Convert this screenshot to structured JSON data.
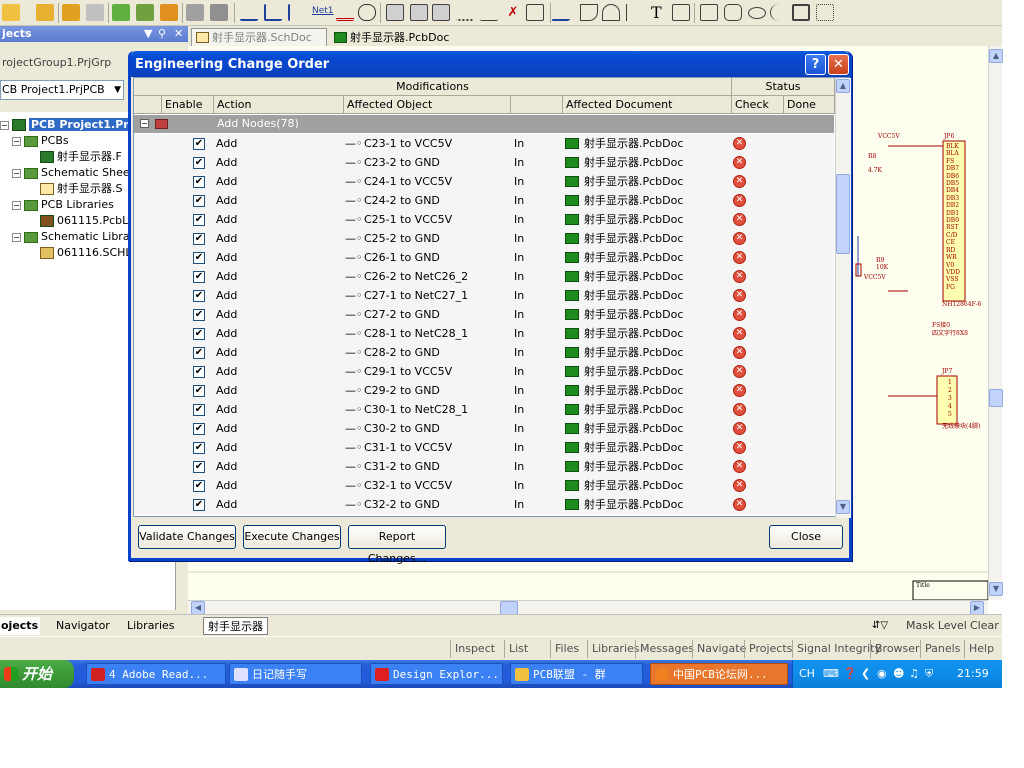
{
  "toolbar": {
    "icons": [
      "open-icon",
      "folder-icon",
      "open-project-icon",
      "close-icon",
      "copy-icon",
      "paste-icon",
      "export-icon",
      "compile-icon",
      "cross-probe-icon",
      "wire-icon",
      "bus-icon",
      "bus-entry-icon",
      "net-label",
      "gnd-icon",
      "port-icon",
      "part-icon",
      "sheet-icon",
      "sheet-entry-icon",
      "harness-icon",
      "junction-icon",
      "no-erc-icon",
      "probe-icon",
      "line-icon",
      "arc-icon",
      "arc2-icon",
      "bezier-icon",
      "text-icon",
      "textframe-icon",
      "rect-icon",
      "rounded-rect-icon",
      "ellipse-icon",
      "pie-icon",
      "image-icon",
      "array-icon"
    ],
    "net_label": "Net1",
    "text_label": "T"
  },
  "projects_panel": {
    "title": "jects",
    "workspace": "rojectGroup1.PrjGrp",
    "project": "CB Project1.PrjPCB",
    "tree": [
      {
        "label": "PCB Project1.PrjP",
        "level": 0,
        "selected": true
      },
      {
        "label": "PCBs",
        "level": 1
      },
      {
        "label": "射手显示器.F",
        "level": 2
      },
      {
        "label": "Schematic Sheets",
        "level": 1
      },
      {
        "label": "射手显示器.S",
        "level": 2
      },
      {
        "label": "PCB Libraries",
        "level": 1
      },
      {
        "label": "061115.PcbLi",
        "level": 2
      },
      {
        "label": "Schematic Librari",
        "level": 1
      },
      {
        "label": "061116.SCHL",
        "level": 2
      }
    ]
  },
  "doc_tabs": [
    {
      "label": "射手显示器.SchDoc"
    },
    {
      "label": "射手显示器.PcbDoc"
    }
  ],
  "dialog": {
    "title": "Engineering Change Order",
    "help_label": "?",
    "close_x": "✕",
    "headers": {
      "modifications": "Modifications",
      "status": "Status",
      "enable": "Enable",
      "action": "Action",
      "affected_object": "Affected Object",
      "affected_document": "Affected Document",
      "check": "Check",
      "done": "Done"
    },
    "group": "Add Nodes(78)",
    "rows": [
      {
        "action": "Add",
        "object": "C23-1 to VCC5V",
        "in": "In",
        "doc": "射手显示器.PcbDoc"
      },
      {
        "action": "Add",
        "object": "C23-2 to GND",
        "in": "In",
        "doc": "射手显示器.PcbDoc"
      },
      {
        "action": "Add",
        "object": "C24-1 to VCC5V",
        "in": "In",
        "doc": "射手显示器.PcbDoc"
      },
      {
        "action": "Add",
        "object": "C24-2 to GND",
        "in": "In",
        "doc": "射手显示器.PcbDoc"
      },
      {
        "action": "Add",
        "object": "C25-1 to VCC5V",
        "in": "In",
        "doc": "射手显示器.PcbDoc"
      },
      {
        "action": "Add",
        "object": "C25-2 to GND",
        "in": "In",
        "doc": "射手显示器.PcbDoc"
      },
      {
        "action": "Add",
        "object": "C26-1 to GND",
        "in": "In",
        "doc": "射手显示器.PcbDoc"
      },
      {
        "action": "Add",
        "object": "C26-2 to NetC26_2",
        "in": "In",
        "doc": "射手显示器.PcbDoc"
      },
      {
        "action": "Add",
        "object": "C27-1 to NetC27_1",
        "in": "In",
        "doc": "射手显示器.PcbDoc"
      },
      {
        "action": "Add",
        "object": "C27-2 to GND",
        "in": "In",
        "doc": "射手显示器.PcbDoc"
      },
      {
        "action": "Add",
        "object": "C28-1 to NetC28_1",
        "in": "In",
        "doc": "射手显示器.PcbDoc"
      },
      {
        "action": "Add",
        "object": "C28-2 to GND",
        "in": "In",
        "doc": "射手显示器.PcbDoc"
      },
      {
        "action": "Add",
        "object": "C29-1 to VCC5V",
        "in": "In",
        "doc": "射手显示器.PcbDoc"
      },
      {
        "action": "Add",
        "object": "C29-2 to GND",
        "in": "In",
        "doc": "射手显示器.PcbDoc"
      },
      {
        "action": "Add",
        "object": "C30-1 to NetC28_1",
        "in": "In",
        "doc": "射手显示器.PcbDoc"
      },
      {
        "action": "Add",
        "object": "C30-2 to GND",
        "in": "In",
        "doc": "射手显示器.PcbDoc"
      },
      {
        "action": "Add",
        "object": "C31-1 to VCC5V",
        "in": "In",
        "doc": "射手显示器.PcbDoc"
      },
      {
        "action": "Add",
        "object": "C31-2 to GND",
        "in": "In",
        "doc": "射手显示器.PcbDoc"
      },
      {
        "action": "Add",
        "object": "C32-1 to VCC5V",
        "in": "In",
        "doc": "射手显示器.PcbDoc"
      },
      {
        "action": "Add",
        "object": "C32-2 to GND",
        "in": "In",
        "doc": "射手显示器.PcbDoc"
      }
    ],
    "buttons": {
      "validate": "Validate Changes",
      "execute": "Execute Changes",
      "report": "Report Changes...",
      "close": "Close"
    }
  },
  "schematic": {
    "labels": [
      "VCC5V",
      "JP6",
      "R8",
      "4.7K",
      "BLK",
      "BLA",
      "FS",
      "DB7",
      "DB6",
      "DB5",
      "DB4",
      "DB3",
      "DB2",
      "DB1",
      "DB0",
      "RST",
      "C/D",
      "CE",
      "RD",
      "WR",
      "V0",
      "VDD",
      "VSS",
      "FG",
      "R9",
      "10K",
      "VCC5V",
      "NH12864F-6",
      "FS接0",
      "四文字行8X8",
      "JP7",
      "1",
      "2",
      "3",
      "4",
      "5",
      "无线模块(4脚)",
      "Title"
    ]
  },
  "bottom_tabs": {
    "projects": "ojects",
    "navigator": "Navigator",
    "libraries": "Libraries",
    "sheet": "射手显示器",
    "mask_level": "Mask Level",
    "clear": "Clear"
  },
  "status_buttons": [
    "Inspect",
    "List",
    "Files",
    "Libraries",
    "Messages",
    "Navigate",
    "Projects",
    "Signal Integrity",
    "Browser",
    "Panels",
    "Help"
  ],
  "taskbar": {
    "start": "开始",
    "tasks": [
      "4 Adobe Read...",
      "日记随手写",
      "Design Explor...",
      "PCB联盟 - 群",
      "中国PCB论坛网..."
    ],
    "lang": "CH",
    "clock": "21:59"
  },
  "colors": {
    "title_blue": "#0842cb",
    "error_red": "#e0503c",
    "taskbar_blue": "#245edb"
  }
}
